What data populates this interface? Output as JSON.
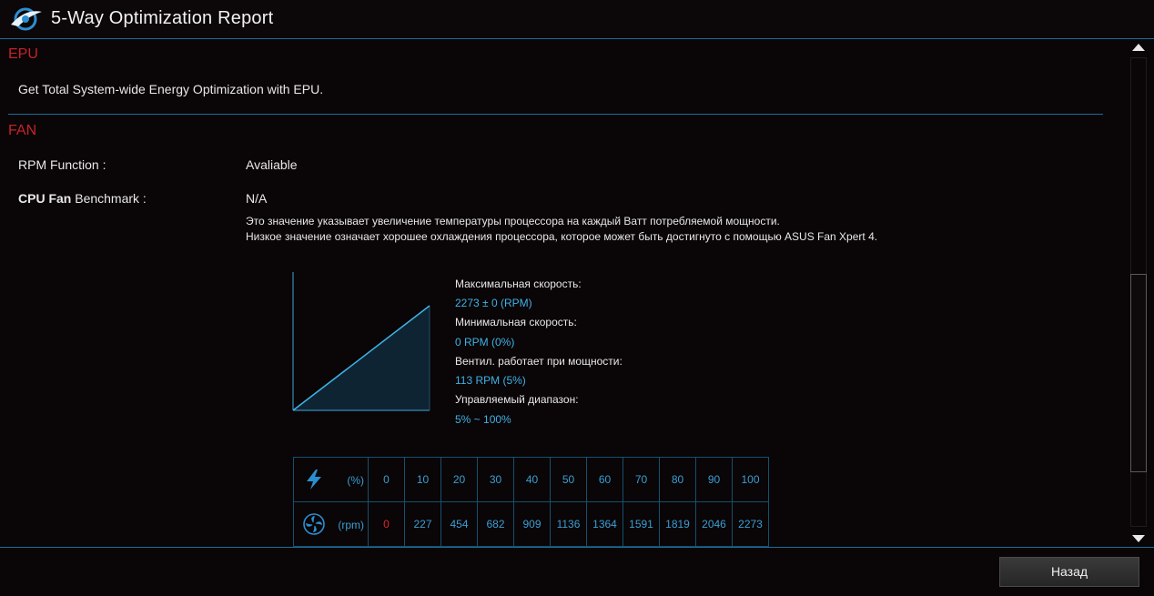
{
  "window": {
    "title": "5-Way Optimization Report"
  },
  "epu": {
    "title": "EPU",
    "description": "Get Total System-wide Energy Optimization with EPU."
  },
  "fan": {
    "title": "FAN",
    "rpm_function_label": "RPM Function :",
    "rpm_function_value": "Avaliable",
    "benchmark_label_bold": "CPU Fan",
    "benchmark_label_rest": " Benchmark :",
    "benchmark_value": "N/A",
    "note_line1": "Это значение указывает увеличение температуры процессора на каждый Ватт потребляемой мощности.",
    "note_line2": "Низкое значение означает хорошее охлаждения процессора, которое может быть достигнуто с помощью ASUS Fan Xpert 4.",
    "specs": {
      "max_label": "Максимальная скорость:",
      "max_value": "2273 ± 0 (RPM)",
      "min_label": "Минимальная скорость:",
      "min_value": "0 RPM (0%)",
      "start_label": "Вентил. работает при мощности:",
      "start_value": "113 RPM (5%)",
      "range_label": "Управляемый диапазон:",
      "range_value": "5% ~ 100%"
    },
    "table": {
      "power_unit": "(%)",
      "rpm_unit": "(rpm)",
      "power": [
        "0",
        "10",
        "20",
        "30",
        "40",
        "50",
        "60",
        "70",
        "80",
        "90",
        "100"
      ],
      "rpm": [
        "0",
        "227",
        "454",
        "682",
        "909",
        "1136",
        "1364",
        "1591",
        "1819",
        "2046",
        "2273"
      ]
    }
  },
  "footer": {
    "back_label": "Назад"
  },
  "colors": {
    "accent": "#1a6e99",
    "section_title": "#c8222a",
    "value_blue": "#3fb3e6"
  },
  "icons": {
    "logo": "asus-logo-icon",
    "power": "lightning-icon",
    "fan": "fan-icon"
  }
}
